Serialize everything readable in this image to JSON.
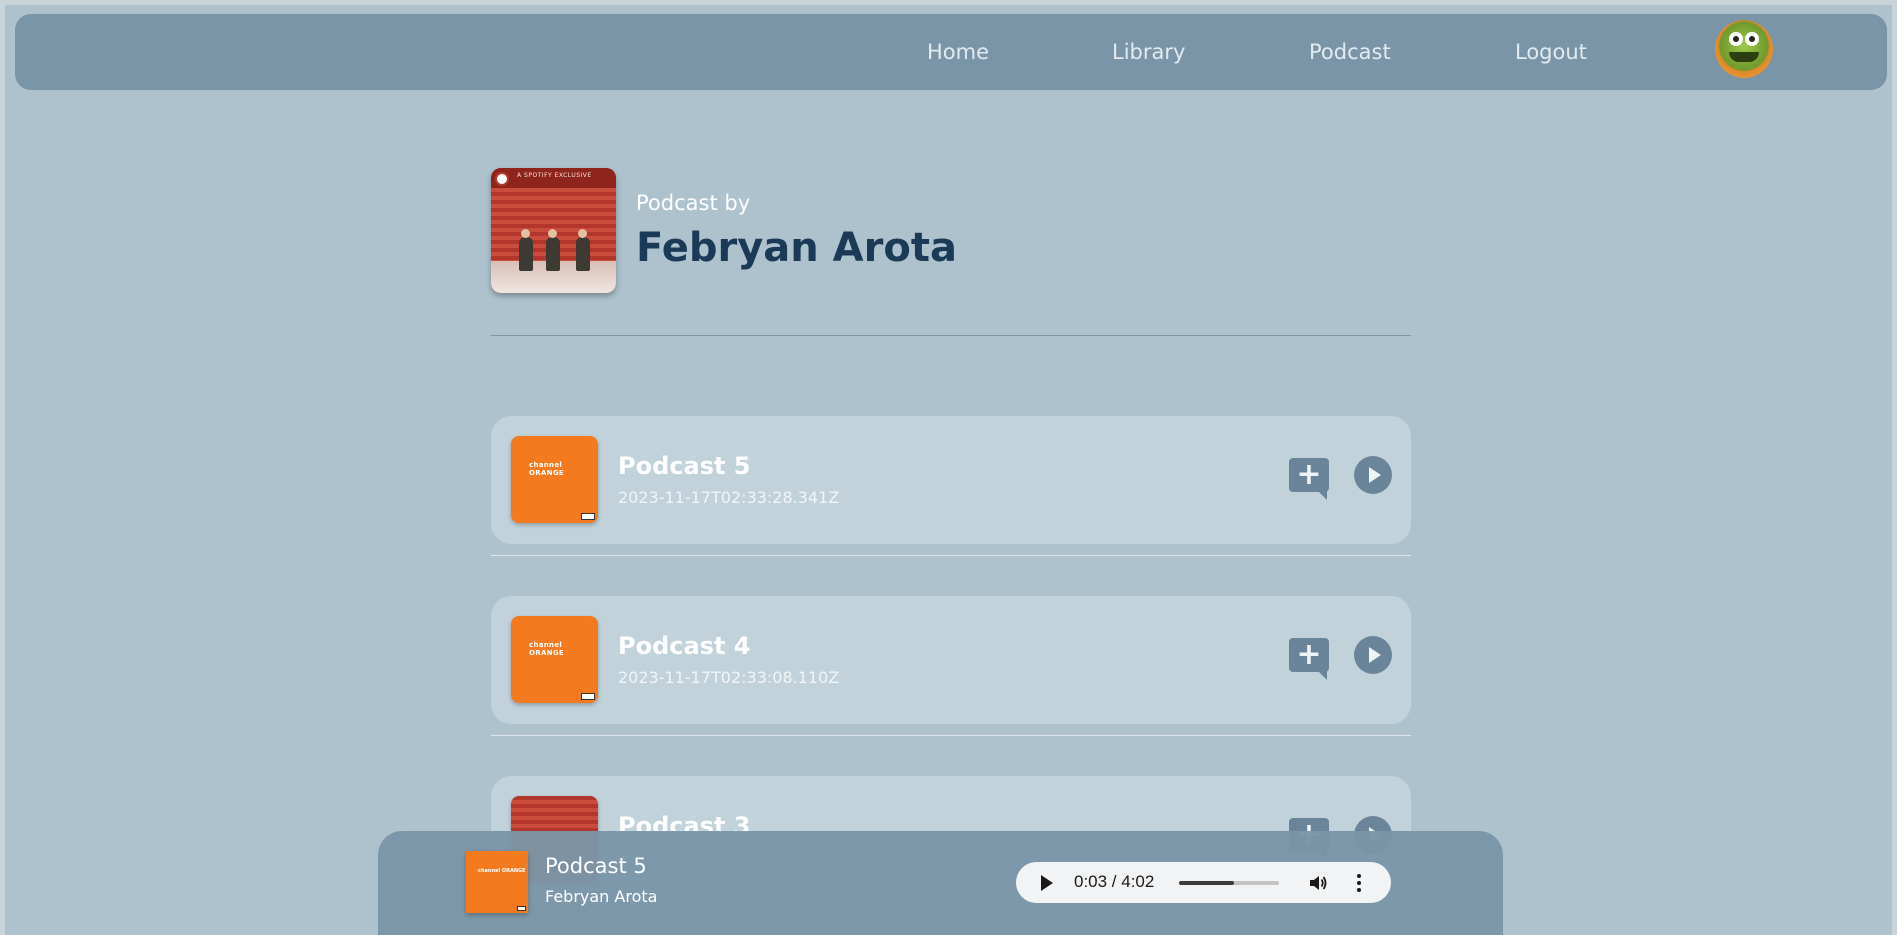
{
  "nav": {
    "links": [
      "Home",
      "Library",
      "Podcast",
      "Logout"
    ],
    "avatar_icon": "kermit-frog-avatar"
  },
  "header": {
    "cover_text": "A SPOTIFY EXCLUSIVE",
    "subtitle": "Podcast by",
    "title": "Febryan Arota"
  },
  "podcasts": [
    {
      "title": "Podcast 5",
      "date": "2023-11-17T02:33:28.341Z",
      "thumb_text": "channel ORANGE",
      "thumb": "orange-album"
    },
    {
      "title": "Podcast 4",
      "date": "2023-11-17T02:33:08.110Z",
      "thumb_text": "channel ORANGE",
      "thumb": "orange-album"
    },
    {
      "title": "Podcast 3",
      "date": "",
      "thumb_text": "",
      "thumb": "red-spotify-exclusive"
    }
  ],
  "player": {
    "thumb_text": "channel ORANGE",
    "title": "Podcast 5",
    "artist": "Febryan Arota",
    "time": "0:03 / 4:02",
    "progress_fraction": 0.55
  },
  "colors": {
    "background": "#adc2cd",
    "navbar": "#7a95a8",
    "card": "#c1d2da",
    "accent": "#6a8599",
    "title": "#1b3a57",
    "orange": "#f47a20"
  }
}
